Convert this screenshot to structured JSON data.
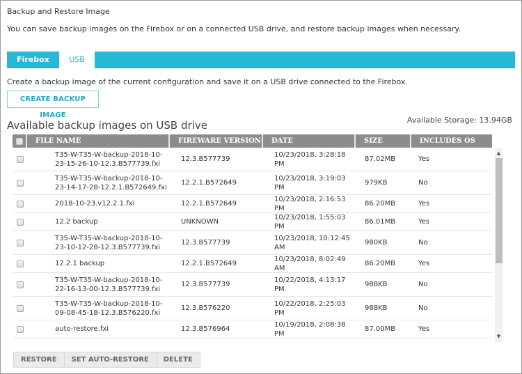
{
  "page": {
    "title": "Backup and Restore Image",
    "description": "You can save backup images on the Firebox or on a connected USB drive, and restore backup images when necessary."
  },
  "tabs": [
    {
      "label": "Firebox",
      "active": false
    },
    {
      "label": "USB",
      "active": true
    }
  ],
  "usb": {
    "description": "Create a backup image of the current configuration and save it on a USB drive connected to the Firebox.",
    "create_button": "CREATE BACKUP IMAGE",
    "section_title": "Available backup images on USB drive",
    "storage": "Available Storage: 13.94GB"
  },
  "table": {
    "columns": [
      "FILE NAME",
      "FIREWARE VERSION",
      "DATE",
      "SIZE",
      "INCLUDES OS"
    ],
    "rows": [
      {
        "name": "T35-W-T35-W-backup-2018-10-23-15-26-10-12.3.B577739.fxi",
        "version": "12.3.B577739",
        "date": "10/23/2018, 3:28:18 PM",
        "size": "87.02MB",
        "os": "Yes"
      },
      {
        "name": "T35-W-T35-W-backup-2018-10-23-14-17-28-12.2.1.B572649.fxi",
        "version": "12.2.1.B572649",
        "date": "10/23/2018, 3:19:03 PM",
        "size": "979KB",
        "os": "No"
      },
      {
        "name": "2018-10-23.v12.2.1.fxi",
        "version": "12.2.1.B572649",
        "date": "10/23/2018, 2:16:53 PM",
        "size": "86.20MB",
        "os": "Yes"
      },
      {
        "name": "12.2 backup",
        "version": "UNKNOWN",
        "date": "10/23/2018, 1:55:03 PM",
        "size": "86.01MB",
        "os": "Yes"
      },
      {
        "name": "T35-W-T35-W-backup-2018-10-23-10-12-28-12.3.B577739.fxi",
        "version": "12.3.B577739",
        "date": "10/23/2018, 10:12:45 AM",
        "size": "980KB",
        "os": "No"
      },
      {
        "name": "12.2.1 backup",
        "version": "12.2.1.B572649",
        "date": "10/23/2018, 8:02:49 AM",
        "size": "86.20MB",
        "os": "Yes"
      },
      {
        "name": "T35-W-T35-W-backup-2018-10-22-16-13-00-12.3.B577739.fxi",
        "version": "12.3.B577739",
        "date": "10/22/2018, 4:13:17 PM",
        "size": "988KB",
        "os": "No"
      },
      {
        "name": "T35-W-T35-W-backup-2018-10-09-08-45-18-12.3.B576220.fxi",
        "version": "12.3.B576220",
        "date": "10/22/2018, 2:25:03 PM",
        "size": "988KB",
        "os": "No"
      },
      {
        "name": "auto-restore.fxi",
        "version": "12.3.B576964",
        "date": "10/19/2018, 2:08:38 PM",
        "size": "87.00MB",
        "os": "Yes"
      }
    ]
  },
  "footer": {
    "restore": "RESTORE",
    "set_auto_restore": "SET AUTO-RESTORE",
    "delete": "DELETE"
  },
  "colors": {
    "accent": "#26b8d4",
    "header_bg": "#8c8c8c"
  }
}
